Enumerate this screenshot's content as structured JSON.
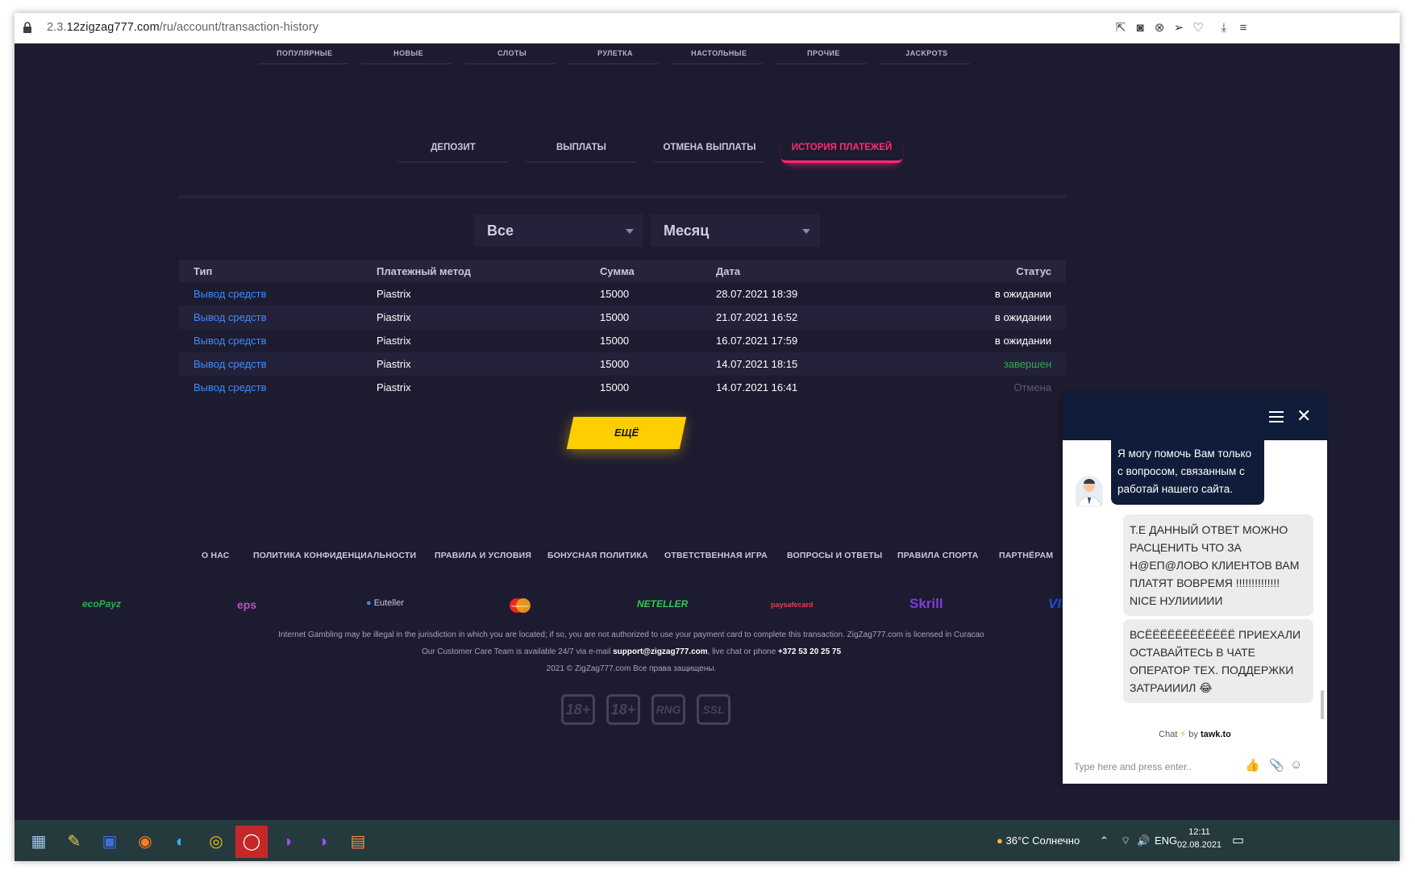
{
  "browser": {
    "url_prefix": "2.3.",
    "url_host": "12zigzag777.com",
    "url_path": "/ru/account/transaction-history"
  },
  "categories": [
    "ПОПУЛЯРНЫЕ",
    "НОВЫЕ",
    "СЛОТЫ",
    "РУЛЕТКА",
    "НАСТОЛЬНЫЕ",
    "ПРОЧИЕ",
    "JACKPOTS"
  ],
  "tabs": [
    {
      "label": "ДЕПОЗИТ",
      "active": false
    },
    {
      "label": "ВЫПЛАТЫ",
      "active": false
    },
    {
      "label": "ОТМЕНА ВЫПЛАТЫ",
      "active": false
    },
    {
      "label": "ИСТОРИЯ ПЛАТЕЖЕЙ",
      "active": true
    }
  ],
  "filters": {
    "type_value": "Все",
    "period_value": "Месяц"
  },
  "table": {
    "headers": [
      "Тип",
      "Платежный метод",
      "Сумма",
      "Дата",
      "Статус"
    ],
    "rows": [
      {
        "type": "Вывод средств",
        "method": "Piastrix",
        "amount": "15000",
        "date": "28.07.2021 18:39",
        "status": "в ожидании",
        "status_kind": "pending"
      },
      {
        "type": "Вывод средств",
        "method": "Piastrix",
        "amount": "15000",
        "date": "21.07.2021 16:52",
        "status": "в ожидании",
        "status_kind": "pending"
      },
      {
        "type": "Вывод средств",
        "method": "Piastrix",
        "amount": "15000",
        "date": "16.07.2021 17:59",
        "status": "в ожидании",
        "status_kind": "pending"
      },
      {
        "type": "Вывод средств",
        "method": "Piastrix",
        "amount": "15000",
        "date": "14.07.2021 18:15",
        "status": "завершен",
        "status_kind": "done"
      },
      {
        "type": "Вывод средств",
        "method": "Piastrix",
        "amount": "15000",
        "date": "14.07.2021 16:41",
        "status": "Отмена",
        "status_kind": "cancelled"
      }
    ]
  },
  "more_button": "ЕЩЁ",
  "footer": {
    "links": [
      "О НАС",
      "ПОЛИТИКА КОНФИДЕНЦИАЛЬНОСТИ",
      "ПРАВИЛА И УСЛОВИЯ",
      "БОНУСНАЯ ПОЛИТИКА",
      "ОТВЕТСТВЕННАЯ ИГРА",
      "ВОПРОСЫ И ОТВЕТЫ",
      "ПРАВИЛА СПОРТА",
      "ПАРТНЁРАМ"
    ],
    "payment_logos": {
      "ecopayz": "ecoPayz",
      "eps": "eps",
      "euteller": "Euteller",
      "mastercard": "MasterCard",
      "neteller": "NETELLER",
      "paysafecard": "paysafecard",
      "skrill": "Skrill",
      "visa": "VIS"
    },
    "disclaimer": "Internet Gambling may be illegal in the jurisdiction in which you are located; if so, you are not authorized to use your payment card to complete this transaction. ZigZag777.com is licensed in Curacao",
    "support_prefix": "Our Customer Care Team is available 24/7 via e-mail",
    "support_email": "support@zigzag777.com",
    "support_middle": ", live chat or phone",
    "support_phone": "+372 53 20 25 75",
    "copyright": "2021 © ZigZag777.com Все права защищены.",
    "badges": [
      "18+",
      "18+",
      "RNG",
      "SSL"
    ]
  },
  "chat": {
    "agent_message": "Я могу помочь Вам только с вопросом, связанным с работай нашего сайта.",
    "user_message_1": "Т.Е ДАННЫЙ ОТВЕТ МОЖНО РАСЦЕНИТЬ ЧТО ЗА Н@ЕП@ЛОВО КЛИЕНТОВ ВАМ ПЛАТЯТ ВОВРЕМЯ !!!!!!!!!!!!!! NICE НУЛИИИИИ",
    "user_message_2": "ВСЁЁЁЁЁЁЁЁЁЁЁЁ ПРИЕХАЛИ ОСТАВАЙТЕСЬ В ЧАТЕ ОПЕРАТОР ТЕХ. ПОДДЕРЖКИ ЗАТРАИИИЛ 😂",
    "powered_prefix": "Chat",
    "powered_by": "by",
    "powered_brand": "tawk.to",
    "input_placeholder": "Type here and press enter.."
  },
  "taskbar": {
    "weather": "36°C  Солнечно",
    "language": "ENG",
    "time": "12:11",
    "date": "02.08.2021"
  },
  "colors": {
    "page_bg": "#1d1b30",
    "accent_pink": "#ff2b72",
    "button_yellow": "#ffce00",
    "link_blue": "#3c8cff",
    "status_done": "#2fa84f",
    "chat_header": "#0f1d3a"
  }
}
